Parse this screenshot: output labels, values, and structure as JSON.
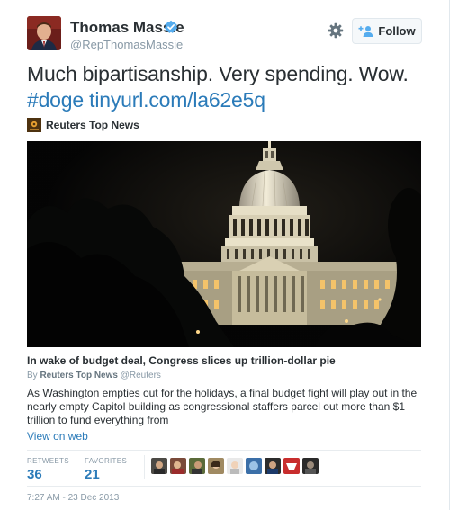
{
  "user": {
    "name": "Thomas Massie",
    "handle": "@RepThomasMassie",
    "verified": true
  },
  "actions": {
    "follow_label": "Follow"
  },
  "tweet": {
    "text_plain": "Much bipartisanship. Very spending.  Wow.",
    "hashtag": "#doge",
    "link": "tinyurl.com/la62e5q"
  },
  "card": {
    "source_name": "Reuters Top News",
    "title": "In wake of budget deal, Congress slices up trillion-dollar pie",
    "by_prefix": "By",
    "by_name": "Reuters Top News",
    "by_handle": "@Reuters",
    "description": "As Washington empties out for the holidays, a final budget fight will play out in the nearly empty Capitol building as congressional staffers parcel out more than $1 trillion to fund everything from",
    "view_label": "View on web"
  },
  "stats": {
    "retweets_label": "RETWEETS",
    "retweets_value": "36",
    "favorites_label": "FAVORITES",
    "favorites_value": "21"
  },
  "timestamp": "7:27 AM - 23 Dec 2013",
  "colors": {
    "link": "#2b7bb9",
    "verified": "#55acee",
    "text": "#292f33",
    "muted": "#8899a6"
  },
  "icons": [
    "verified-badge-icon",
    "gear-icon",
    "follow-person-plus-icon",
    "reuters-logo-icon"
  ]
}
